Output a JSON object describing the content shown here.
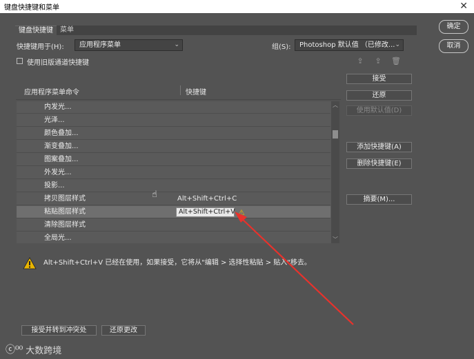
{
  "window": {
    "title": "键盘快捷键和菜单",
    "close_glyph": "✕"
  },
  "tabs": [
    {
      "label": "键盘快捷键"
    },
    {
      "label": "菜单"
    }
  ],
  "shortcuts_for": {
    "label": "快捷键用于(H):",
    "value": "应用程序菜单"
  },
  "group": {
    "label": "组(S):",
    "value": "Photoshop 默认值 （已修改..."
  },
  "legacy_channel": {
    "label": "使用旧版通道快捷键",
    "checked": false
  },
  "table": {
    "col_command": "应用程序菜单命令",
    "col_shortcut": "快捷键",
    "rows": [
      {
        "name": "内发光...",
        "shortcut": ""
      },
      {
        "name": "光泽...",
        "shortcut": ""
      },
      {
        "name": "颜色叠加...",
        "shortcut": ""
      },
      {
        "name": "渐变叠加...",
        "shortcut": ""
      },
      {
        "name": "图案叠加...",
        "shortcut": ""
      },
      {
        "name": "外发光...",
        "shortcut": ""
      },
      {
        "name": "投影...",
        "shortcut": ""
      },
      {
        "name": "拷贝图层样式",
        "shortcut": "Alt+Shift+Ctrl+C"
      },
      {
        "name": "粘贴图层样式",
        "shortcut": "Alt+Shift+Ctrl+V",
        "selected": true
      },
      {
        "name": "清除图层样式",
        "shortcut": ""
      },
      {
        "name": "全局光...",
        "shortcut": ""
      }
    ]
  },
  "side_buttons": {
    "accept": "接受",
    "undo": "还原",
    "use_default": "使用默认值(D)",
    "add_shortcut": "添加快捷键(A)",
    "delete_shortcut": "删除快捷键(E)",
    "summary": "摘要(M)..."
  },
  "dialog_buttons": {
    "ok": "确定",
    "cancel": "取消"
  },
  "warning": {
    "message": "Alt+Shift+Ctrl+V 已经在使用，如果接受，它将从\"编辑 > 选择性粘贴 > 贴入\"移去。"
  },
  "bottom_buttons": {
    "accept_go_conflict": "接受并转到冲突处",
    "undo_changes": "还原更改"
  },
  "watermark": {
    "logo": "ⓒ⁰⁰",
    "text": "大数跨境"
  },
  "colors": {
    "dialog_bg": "#535353",
    "warning": "#e8b400",
    "annotation_arrow": "#e8322c"
  }
}
